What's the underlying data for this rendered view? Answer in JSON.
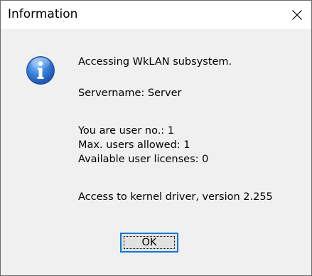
{
  "window": {
    "title": "Information",
    "close_glyph": "✕"
  },
  "icon": {
    "name": "info-icon",
    "glyph": "i",
    "color": "#2a6fd0"
  },
  "message": {
    "line1": "Accessing WkLAN subsystem.",
    "line2": "Servername: Server",
    "line3": "You are user no.: 1",
    "line4": "Max. users allowed: 1",
    "line5": "Available user licenses: 0",
    "line6": "Access to kernel driver, version 2.255"
  },
  "buttons": {
    "ok_label": "OK"
  },
  "colors": {
    "accent": "#0078d7",
    "background": "#f0f0f0",
    "titlebar": "#ffffff"
  }
}
